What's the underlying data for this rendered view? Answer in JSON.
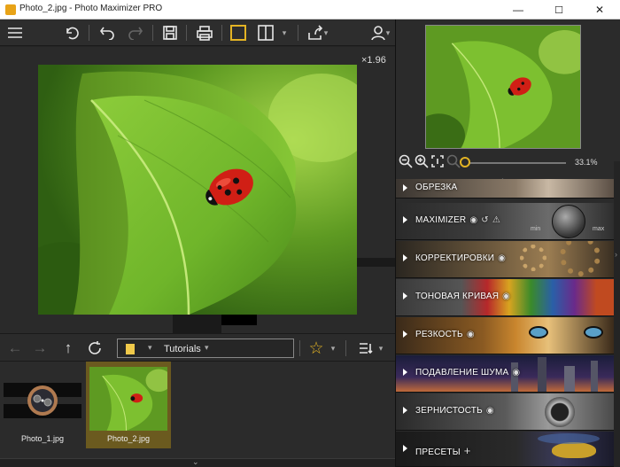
{
  "window": {
    "title": "Photo_2.jpg - Photo Maximizer PRO",
    "minimize": "—",
    "maximize": "☐",
    "close": "✕"
  },
  "canvas": {
    "zoom_label": "×1.96"
  },
  "navigation": {
    "folder": "Tutorials"
  },
  "thumbnails": [
    {
      "label": "Photo_1.jpg",
      "selected": false
    },
    {
      "label": "Photo_2.jpg",
      "selected": true
    }
  ],
  "navigator": {
    "zoom_percent": "33.1%"
  },
  "panels": [
    {
      "label": "ОБРЕЗКА",
      "eye": false
    },
    {
      "label": "MAXIMIZER",
      "eye": true
    },
    {
      "label": "КОРРЕКТИРОВКИ",
      "eye": true
    },
    {
      "label": "ТОНОВАЯ КРИВАЯ",
      "eye": true
    },
    {
      "label": "РЕЗКОСТЬ",
      "eye": true
    },
    {
      "label": "ПОДАВЛЕНИЕ ШУМА",
      "eye": true
    },
    {
      "label": "ЗЕРНИСТОСТЬ",
      "eye": true
    },
    {
      "label": "ПРЕСЕТЫ",
      "eye": false
    }
  ],
  "maximizer_dial": {
    "min": "min",
    "max": "max"
  },
  "colors": {
    "accent": "#e3b324",
    "selected_thumb": "#6b5a1f"
  }
}
